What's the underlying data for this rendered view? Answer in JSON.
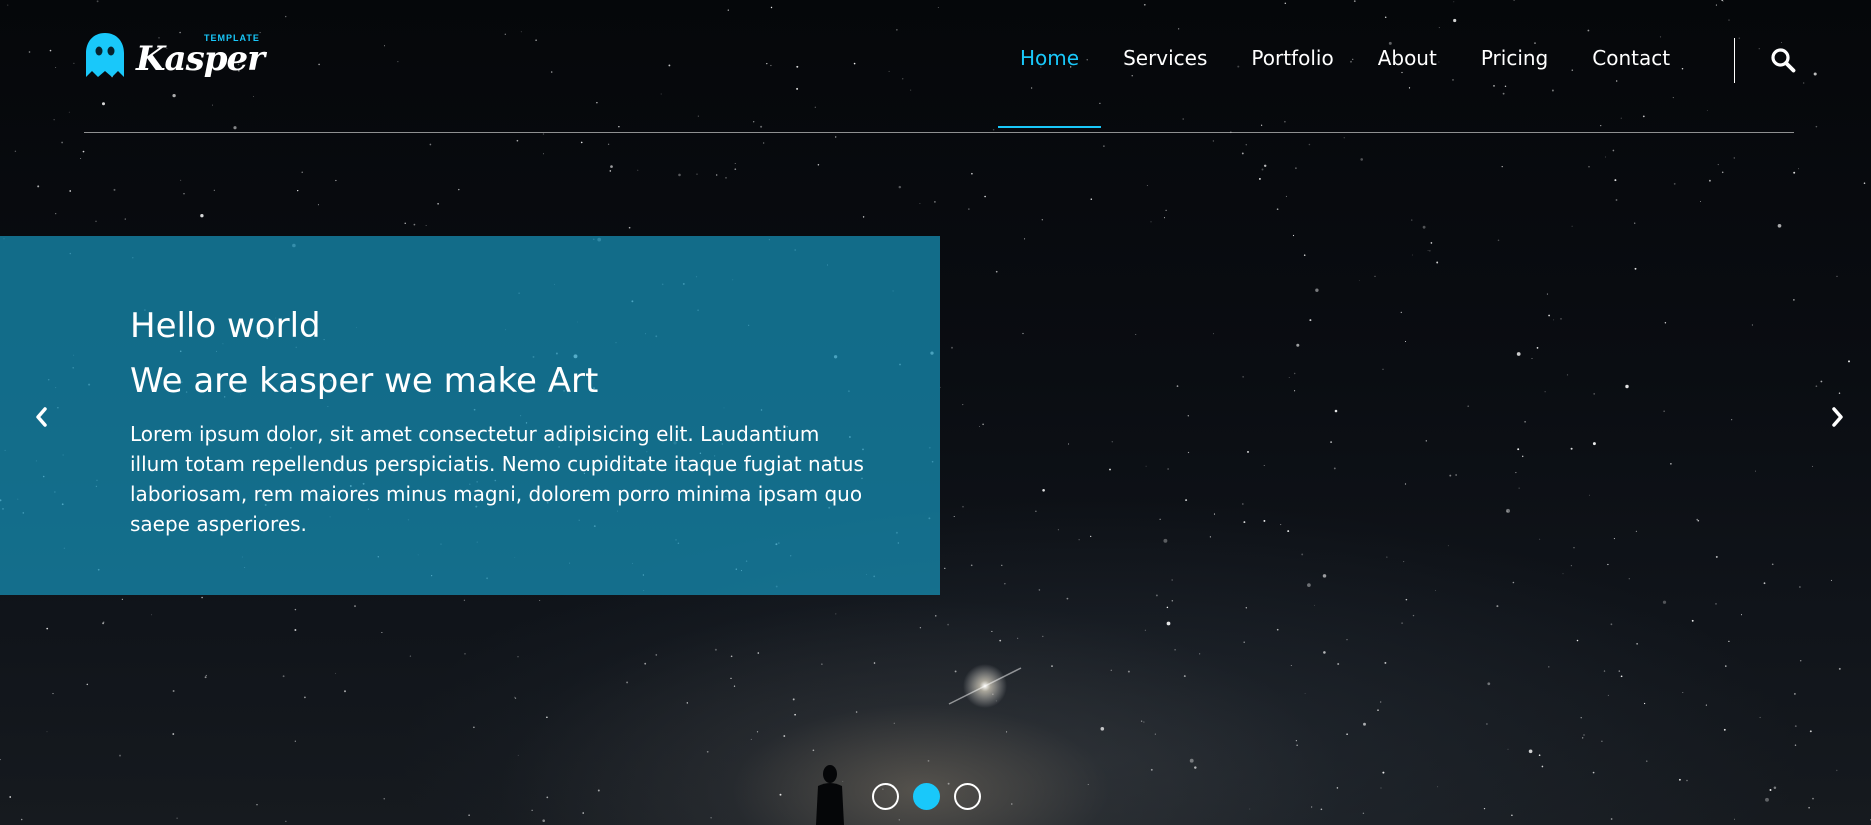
{
  "brand": {
    "name": "Kasper",
    "sub": "TEMPLATE",
    "accent_color": "#19c8fa"
  },
  "nav": {
    "items": [
      {
        "label": "Home",
        "active": true
      },
      {
        "label": "Services",
        "active": false
      },
      {
        "label": "Portfolio",
        "active": false
      },
      {
        "label": "About",
        "active": false
      },
      {
        "label": "Pricing",
        "active": false
      },
      {
        "label": "Contact",
        "active": false
      }
    ],
    "search_icon": "search-icon"
  },
  "hero": {
    "title_line1": "Hello world",
    "title_line2": "We are kasper we make Art",
    "text": "Lorem ipsum dolor, sit amet consectetur adipisicing elit. Laudantium illum totam repellendus perspiciatis. Nemo cupiditate itaque fugiat natus laboriosam, rem maiores minus magni, dolorem porro minima ipsam quo saepe asperiores.",
    "box_color": "#1691b9",
    "prev_icon": "chevron-left-icon",
    "next_icon": "chevron-right-icon",
    "slides": 3,
    "active_slide": 2
  }
}
